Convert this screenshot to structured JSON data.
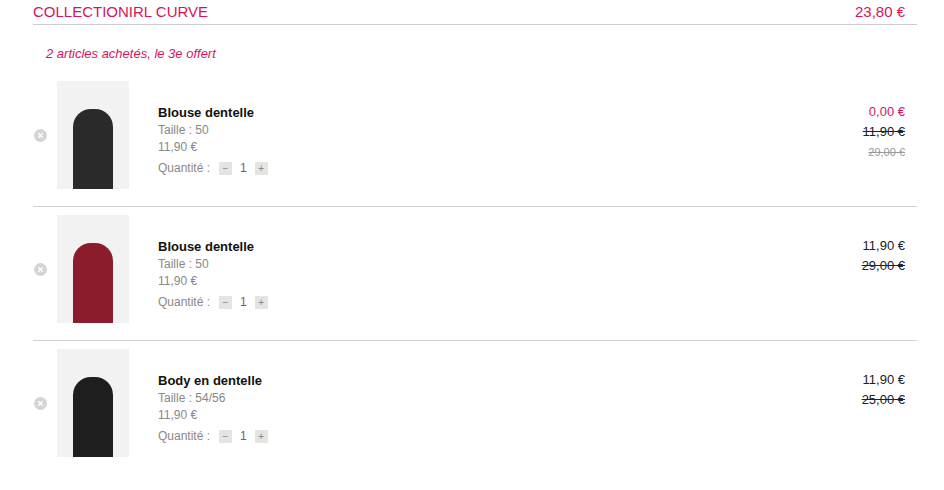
{
  "cart_group": {
    "title": "COLLECTIONIRL CURVE",
    "total": "23,80 €",
    "promo": "2 articles achetés, le 3e offert"
  },
  "items": [
    {
      "name": "Blouse dentelle",
      "size": "Taille : 50",
      "unit_price": "11,90 €",
      "quantity_label": "Quantité :",
      "quantity": "1",
      "minus": "−",
      "plus": "+",
      "photo_color": "#2a2a2a",
      "price_lines": [
        {
          "text": "0,00 €",
          "struck": false,
          "highlight": true
        },
        {
          "text": "11,90 €",
          "struck": true,
          "highlight": false
        },
        {
          "text": "29,00 €",
          "struck": true,
          "highlight": false
        }
      ]
    },
    {
      "name": "Blouse dentelle",
      "size": "Taille : 50",
      "unit_price": "11,90 €",
      "quantity_label": "Quantité :",
      "quantity": "1",
      "minus": "−",
      "plus": "+",
      "photo_color": "#8a1c2b",
      "price_lines": [
        {
          "text": "11,90 €",
          "struck": false,
          "highlight": false
        },
        {
          "text": "29,00 €",
          "struck": true,
          "highlight": false
        }
      ]
    },
    {
      "name": "Body en dentelle",
      "size": "Taille : 54/56",
      "unit_price": "11,90 €",
      "quantity_label": "Quantité :",
      "quantity": "1",
      "minus": "−",
      "plus": "+",
      "photo_color": "#1e1e1e",
      "price_lines": [
        {
          "text": "11,90 €",
          "struck": false,
          "highlight": false
        },
        {
          "text": "25,00 €",
          "struck": true,
          "highlight": false
        }
      ]
    }
  ]
}
